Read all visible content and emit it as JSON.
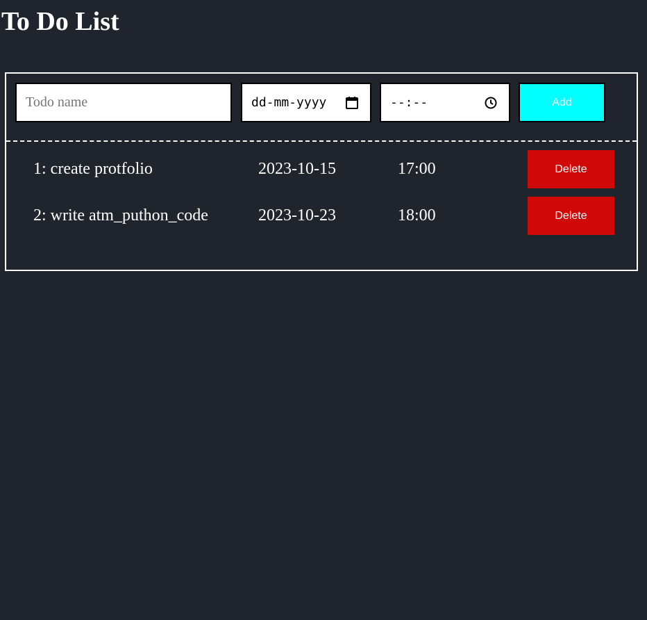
{
  "page": {
    "title": "To Do List"
  },
  "form": {
    "name_placeholder": "Todo name",
    "date_placeholder": "dd-mm-yyyy",
    "time_placeholder": "--:--",
    "add_label": "Add",
    "date_icon": "calendar-icon",
    "time_icon": "clock-icon"
  },
  "todos": [
    {
      "index_name": "1: create protfolio",
      "date": "2023-10-15",
      "time": "17:00",
      "delete_label": "Delete"
    },
    {
      "index_name": "2: write atm_puthon_code",
      "date": "2023-10-23",
      "time": "18:00",
      "delete_label": "Delete"
    }
  ],
  "colors": {
    "background": "#20242c",
    "add_button": "#00ffff",
    "delete_button": "#d10808",
    "border": "#ffffff"
  }
}
